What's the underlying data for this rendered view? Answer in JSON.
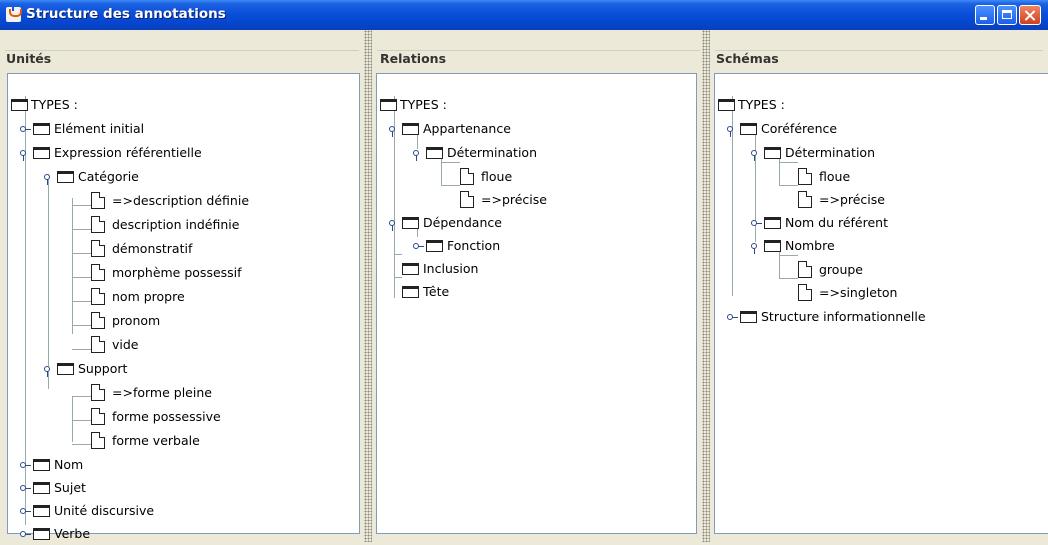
{
  "window": {
    "title": "Structure des annotations"
  },
  "panels": {
    "unites": {
      "label": "Unités",
      "root": "TYPES :",
      "items": {
        "element_initial": "Elément initial",
        "expression_referentielle": "Expression référentielle",
        "categorie": "Catégorie",
        "description_definie": "=>description définie",
        "description_indefinie": "description indéfinie",
        "demonstratif": "démonstratif",
        "morpheme_possessif": "morphème possessif",
        "nom_propre": "nom propre",
        "pronom": "pronom",
        "vide": "vide",
        "support": "Support",
        "forme_pleine": "=>forme pleine",
        "forme_possessive": "forme possessive",
        "forme_verbale": "forme verbale",
        "nom": "Nom",
        "sujet": "Sujet",
        "unite_discursive": "Unité discursive",
        "verbe": "Verbe"
      }
    },
    "relations": {
      "label": "Relations",
      "root": "TYPES :",
      "items": {
        "appartenance": "Appartenance",
        "determination": "Détermination",
        "floue": "floue",
        "precise": "=>précise",
        "dependance": "Dépendance",
        "fonction": "Fonction",
        "inclusion": "Inclusion",
        "tete": "Tête"
      }
    },
    "schemas": {
      "label": "Schémas",
      "root": "TYPES :",
      "items": {
        "coreference": "Coréférence",
        "determination": "Détermination",
        "floue": "floue",
        "precise": "=>précise",
        "nom_du_referent": "Nom du référent",
        "nombre": "Nombre",
        "groupe": "groupe",
        "singleton": "=>singleton",
        "structure_informationnelle": "Structure informationnelle"
      }
    }
  }
}
